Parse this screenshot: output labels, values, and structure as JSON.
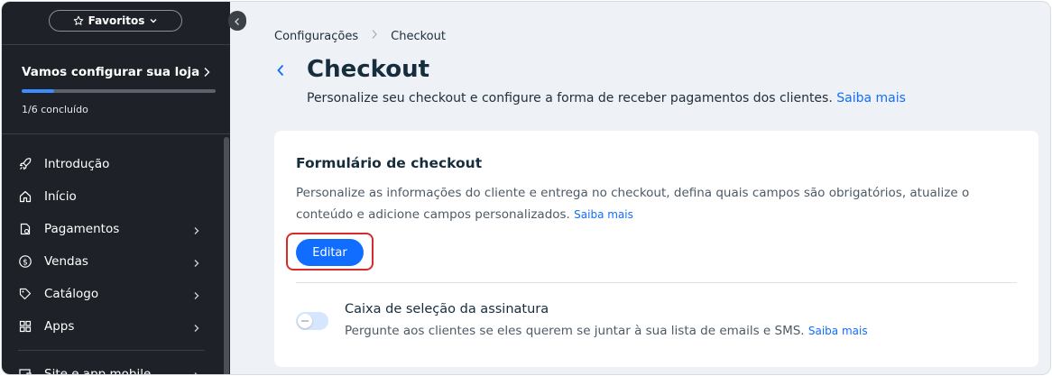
{
  "sidebar": {
    "favorites_label": "Favoritos",
    "setup": {
      "title": "Vamos configurar sua loja",
      "progress": 0.1667,
      "progress_text": "1/6 concluído"
    },
    "items": [
      {
        "label": "Introdução",
        "icon": "rocket-icon",
        "has_chevron": false
      },
      {
        "label": "Início",
        "icon": "home-icon",
        "has_chevron": false
      },
      {
        "label": "Pagamentos",
        "icon": "payments-icon",
        "has_chevron": true
      },
      {
        "label": "Vendas",
        "icon": "dollar-circle-icon",
        "has_chevron": true
      },
      {
        "label": "Catálogo",
        "icon": "tag-icon",
        "has_chevron": true
      },
      {
        "label": "Apps",
        "icon": "apps-grid-icon",
        "has_chevron": true
      },
      {
        "label": "Site e app mobile",
        "icon": "site-icon",
        "has_chevron": true
      }
    ]
  },
  "breadcrumb": {
    "parent": "Configurações",
    "current": "Checkout"
  },
  "header": {
    "title": "Checkout",
    "subtitle": "Personalize seu checkout e configure a forma de receber pagamentos dos clientes.",
    "learn_more": "Saiba mais"
  },
  "checkout_form": {
    "title": "Formulário de checkout",
    "description": "Personalize as informações do cliente e entrega no checkout, defina quais campos são obrigatórios, atualize o conteúdo e adicione campos personalizados.",
    "learn_more": "Saiba mais",
    "edit_label": "Editar"
  },
  "signature_option": {
    "title": "Caixa de seleção da assinatura",
    "description": "Pergunte aos clientes se eles querem se juntar à sua lista de emails e SMS.",
    "learn_more": "Saiba mais",
    "enabled": false
  },
  "colors": {
    "accent": "#116dff",
    "sidebar_bg": "#1e2127",
    "highlight": "#d72b2b"
  }
}
